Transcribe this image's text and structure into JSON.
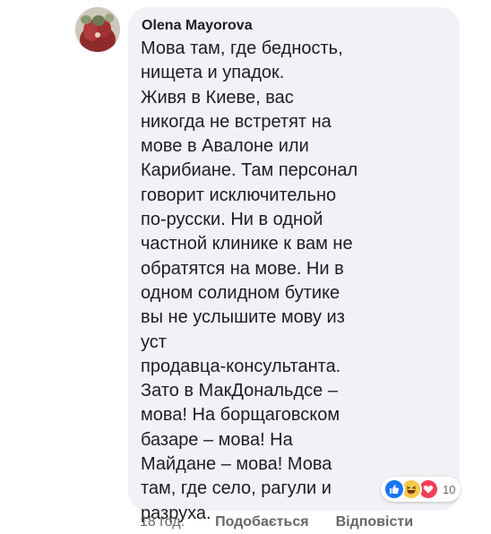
{
  "comment": {
    "author": "Olena Mayorova",
    "text": "Мова там, где бедность,\nнищета и упадок.\nЖивя в Киеве, вас\nникогда не встретят на\nмове в Авалоне или\nКарибиане. Там персонал\nговорит исключительно\nпо-русски. Ни в одной\nчастной клинике к вам не\nобратятся на мове. Ни в\nодном солидном бутике\nвы не услышите мову из\nуст\nпродавца-консультанта.\nЗато в МакДональдсе –\nмова! На борщаговском\nбазаре – мова! На\nМайдане – мова! Мова\nтам, где село, рагули и\nразруха.",
    "reactions": {
      "icons": [
        "like-icon",
        "haha-icon",
        "love-icon"
      ],
      "count": "10"
    }
  },
  "actions": {
    "timestamp": "18 год.",
    "like_label": "Подобається",
    "reply_label": "Відповісти"
  },
  "colors": {
    "bubble": "#f0f2f5",
    "text": "#1c1e21",
    "secondary": "#65676b",
    "like": "#1877f2",
    "love": "#f33e58",
    "haha": "#f7c94a"
  }
}
